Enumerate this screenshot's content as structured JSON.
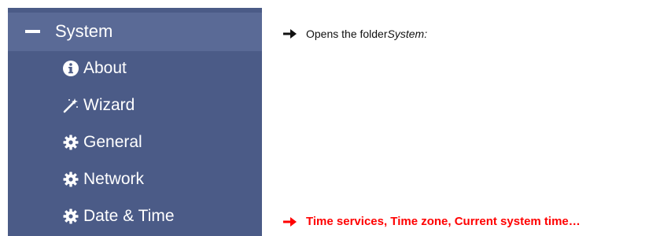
{
  "sidebar": {
    "folder_label": "System",
    "items": [
      {
        "label": "About",
        "icon": "info-circle-icon"
      },
      {
        "label": "Wizard",
        "icon": "magic-wand-icon"
      },
      {
        "label": "General",
        "icon": "gear-icon"
      },
      {
        "label": "Network",
        "icon": "gear-icon"
      },
      {
        "label": "Date & Time",
        "icon": "gear-icon"
      }
    ]
  },
  "notes": {
    "system_prefix": "Opens the folder ",
    "system_emph": "System:",
    "date_time": "Time services, Time zone, Current system time…"
  },
  "colors": {
    "sidebar_bg": "#4b5b87",
    "header_bg": "#5a6a96",
    "highlight_text": "#ff0000"
  }
}
